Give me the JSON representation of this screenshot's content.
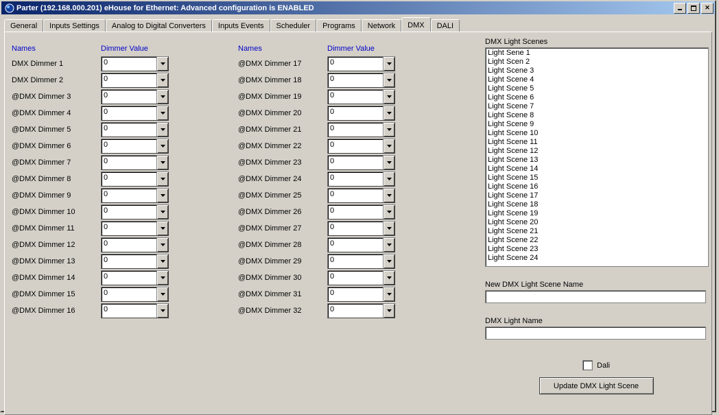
{
  "title": "Parter (192.168.000.201)     eHouse for Ethernet: Advanced configuration is ENABLED",
  "tabs": [
    "General",
    "Inputs Settings",
    "Analog to Digital Converters",
    "Inputs Events",
    "Scheduler",
    "Programs",
    "Network",
    "DMX",
    "DALI"
  ],
  "active_tab": 7,
  "headers": {
    "names": "Names",
    "dimmer": "Dimmer Value"
  },
  "dimmers_left": [
    {
      "name": "DMX Dimmer 1",
      "value": "0"
    },
    {
      "name": "DMX Dimmer 2",
      "value": "0"
    },
    {
      "name": "@DMX Dimmer 3",
      "value": "0"
    },
    {
      "name": "@DMX Dimmer 4",
      "value": "0"
    },
    {
      "name": "@DMX Dimmer 5",
      "value": "0"
    },
    {
      "name": "@DMX Dimmer 6",
      "value": "0"
    },
    {
      "name": "@DMX Dimmer 7",
      "value": "0"
    },
    {
      "name": "@DMX Dimmer 8",
      "value": "0"
    },
    {
      "name": "@DMX Dimmer 9",
      "value": "0"
    },
    {
      "name": "@DMX Dimmer 10",
      "value": "0"
    },
    {
      "name": "@DMX Dimmer 11",
      "value": "0"
    },
    {
      "name": "@DMX Dimmer 12",
      "value": "0"
    },
    {
      "name": "@DMX Dimmer 13",
      "value": "0"
    },
    {
      "name": "@DMX Dimmer 14",
      "value": "0"
    },
    {
      "name": "@DMX Dimmer 15",
      "value": "0"
    },
    {
      "name": "@DMX Dimmer 16",
      "value": "0"
    }
  ],
  "dimmers_right": [
    {
      "name": "@DMX Dimmer 17",
      "value": "0"
    },
    {
      "name": "@DMX Dimmer 18",
      "value": "0"
    },
    {
      "name": "@DMX Dimmer 19",
      "value": "0"
    },
    {
      "name": "@DMX Dimmer 20",
      "value": "0"
    },
    {
      "name": "@DMX Dimmer 21",
      "value": "0"
    },
    {
      "name": "@DMX Dimmer 22",
      "value": "0"
    },
    {
      "name": "@DMX Dimmer 23",
      "value": "0"
    },
    {
      "name": "@DMX Dimmer 24",
      "value": "0"
    },
    {
      "name": "@DMX Dimmer 25",
      "value": "0"
    },
    {
      "name": "@DMX Dimmer 26",
      "value": "0"
    },
    {
      "name": "@DMX Dimmer 27",
      "value": "0"
    },
    {
      "name": "@DMX Dimmer 28",
      "value": "0"
    },
    {
      "name": "@DMX Dimmer 29",
      "value": "0"
    },
    {
      "name": "@DMX Dimmer 30",
      "value": "0"
    },
    {
      "name": "@DMX Dimmer 31",
      "value": "0"
    },
    {
      "name": "@DMX Dimmer 32",
      "value": "0"
    }
  ],
  "scenes_label": "DMX Light Scenes",
  "scenes": [
    "Light Sene 1",
    "Light Scen 2",
    "Light Scene 3",
    "Light Scene 4",
    "Light Scene 5",
    "Light Scene 6",
    "Light Scene 7",
    "Light Scene 8",
    "Light Scene 9",
    "Light Scene 10",
    "Light Scene 11",
    "Light Scene 12",
    "Light Scene 13",
    "Light Scene 14",
    "Light Scene 15",
    "Light Scene 16",
    "Light Scene 17",
    "Light Scene 18",
    "Light Scene 19",
    "Light Scene 20",
    "Light Scene 21",
    "Light Scene 22",
    "Light Scene 23",
    "Light Scene 24"
  ],
  "new_scene_label": "New DMX Light Scene Name",
  "light_name_label": "DMX Light Name",
  "new_scene_value": "",
  "light_name_value": "",
  "dali_checkbox": "Dali",
  "dali_checked": false,
  "update_button": "Update DMX Light Scene"
}
